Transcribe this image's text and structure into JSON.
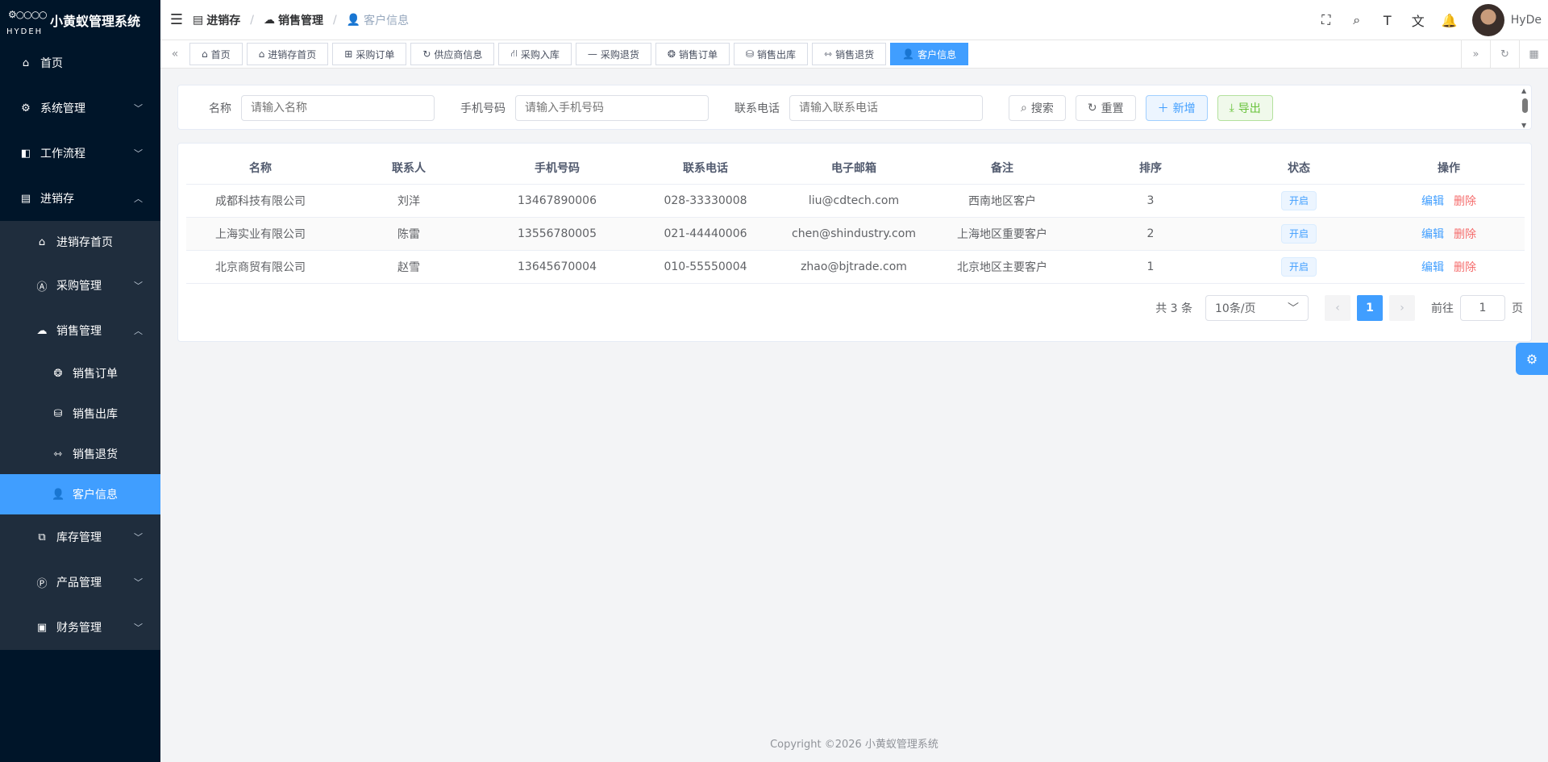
{
  "app": {
    "title": "小黄蚁管理系统",
    "logo_text": "HYDEH"
  },
  "sidebar": {
    "items": [
      {
        "label": "首页"
      },
      {
        "label": "系统管理"
      },
      {
        "label": "工作流程"
      },
      {
        "label": "进销存"
      },
      {
        "label": "进销存首页"
      },
      {
        "label": "采购管理"
      },
      {
        "label": "销售管理"
      },
      {
        "label": "销售订单"
      },
      {
        "label": "销售出库"
      },
      {
        "label": "销售退货"
      },
      {
        "label": "客户信息"
      },
      {
        "label": "库存管理"
      },
      {
        "label": "产品管理"
      },
      {
        "label": "财务管理"
      }
    ]
  },
  "breadcrumb": {
    "items": [
      "进销存",
      "销售管理",
      "客户信息"
    ]
  },
  "user": {
    "name": "HyDe"
  },
  "tags": {
    "items": [
      "首页",
      "进销存首页",
      "采购订单",
      "供应商信息",
      "采购入库",
      "采购退货",
      "销售订单",
      "销售出库",
      "销售退货",
      "客户信息"
    ]
  },
  "search": {
    "name_label": "名称",
    "name_placeholder": "请输入名称",
    "mobile_label": "手机号码",
    "mobile_placeholder": "请输入手机号码",
    "phone_label": "联系电话",
    "phone_placeholder": "请输入联系电话",
    "search_btn": "搜索",
    "reset_btn": "重置",
    "add_btn": "新增",
    "export_btn": "导出"
  },
  "table": {
    "headers": [
      "名称",
      "联系人",
      "手机号码",
      "联系电话",
      "电子邮箱",
      "备注",
      "排序",
      "状态",
      "操作"
    ],
    "rows": [
      {
        "name": "成都科技有限公司",
        "contact": "刘洋",
        "mobile": "13467890006",
        "phone": "028-33330008",
        "email": "liu@cdtech.com",
        "remark": "西南地区客户",
        "sort": "3",
        "status": "开启"
      },
      {
        "name": "上海实业有限公司",
        "contact": "陈雷",
        "mobile": "13556780005",
        "phone": "021-44440006",
        "email": "chen@shindustry.com",
        "remark": "上海地区重要客户",
        "sort": "2",
        "status": "开启"
      },
      {
        "name": "北京商贸有限公司",
        "contact": "赵雪",
        "mobile": "13645670004",
        "phone": "010-55550004",
        "email": "zhao@bjtrade.com",
        "remark": "北京地区主要客户",
        "sort": "1",
        "status": "开启"
      }
    ],
    "edit_label": "编辑",
    "delete_label": "删除"
  },
  "pagination": {
    "total": "共 3 条",
    "page_size": "10条/页",
    "current": "1",
    "goto_label": "前往",
    "goto_value": "1",
    "page_unit": "页"
  },
  "footer": {
    "text": "Copyright ©2026 小黄蚁管理系统"
  },
  "colors": {
    "primary": "#409eff",
    "sidebar_bg": "#001529",
    "submenu_bg": "#1f2d3d",
    "danger": "#f56c6c",
    "success": "#67c23a"
  }
}
